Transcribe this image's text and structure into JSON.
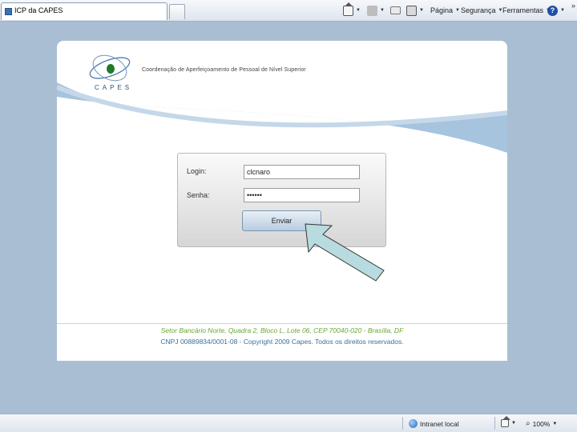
{
  "browser": {
    "tab_title": "ICP da CAPES",
    "toolbar": {
      "pagina": "Página",
      "seguranca": "Segurança",
      "ferramentas": "Ferramentas"
    },
    "status": {
      "zone": "Intranet local",
      "zoom": "100%"
    }
  },
  "page": {
    "logo_text": "CAPES",
    "org_name": "Coordenação de Aperfeiçoamento de Pessoal de Nível Superior",
    "login": {
      "login_label": "Login:",
      "login_value": "clcnaro",
      "senha_label": "Senha:",
      "senha_value": "••••••",
      "submit_label": "Enviar"
    },
    "footer": {
      "address": "Setor Bancário Norte, Quadra 2, Bloco L, Lote 06, CEP 70040-020 - Brasília, DF",
      "copyright": "CNPJ 00889834/0001-08 - Copyright 2009 Capes. Todos os direitos reservados."
    }
  },
  "colors": {
    "background": "#a9bed3",
    "swoosh": "#a7c4de",
    "logo_green": "#1f7a2a",
    "footer_green": "#6aa534",
    "footer_blue": "#3d6f9a",
    "pointer_arrow": "#b8dbe0"
  }
}
